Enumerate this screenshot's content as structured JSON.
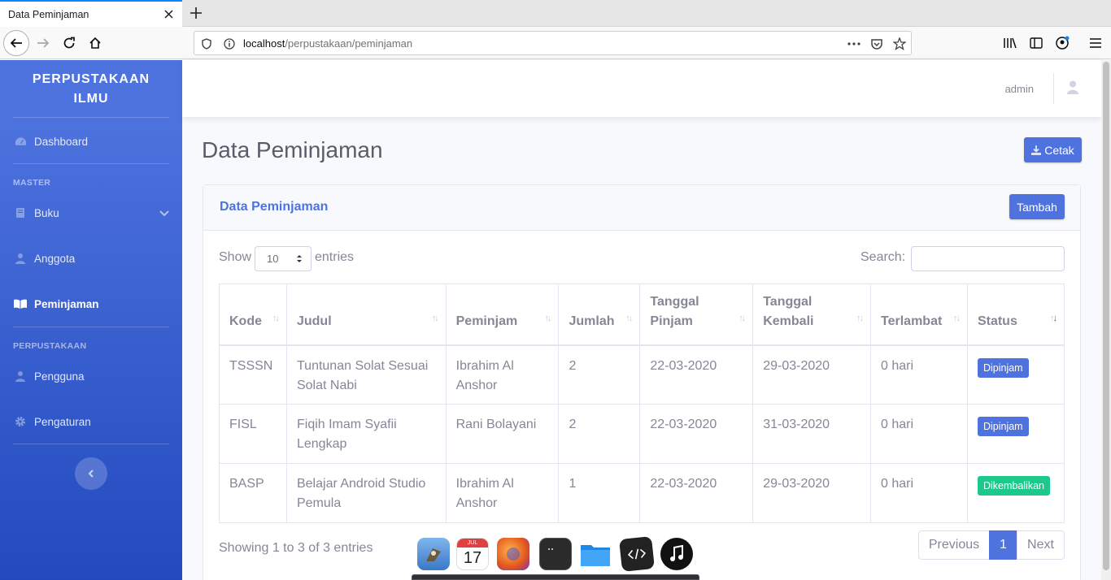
{
  "browser": {
    "tab_title": "Data Peminjaman",
    "url_host": "localhost",
    "url_path": "/perpustakaan/peminjaman"
  },
  "sidebar": {
    "brand_line1": "PERPUSTAKAAN",
    "brand_line2": "ILMU",
    "items": [
      {
        "label": "Dashboard",
        "icon": "dashboard-icon"
      },
      {
        "label": "Buku",
        "icon": "book-icon"
      },
      {
        "label": "Anggota",
        "icon": "user-icon"
      },
      {
        "label": "Peminjaman",
        "icon": "book-open-icon"
      },
      {
        "label": "Pengguna",
        "icon": "user-icon"
      },
      {
        "label": "Pengaturan",
        "icon": "cog-icon"
      }
    ],
    "heading_master": "MASTER",
    "heading_perpustakaan": "PERPUSTAKAAN"
  },
  "topbar": {
    "username": "admin"
  },
  "main": {
    "page_title": "Data Peminjaman",
    "cetak_label": "Cetak",
    "card_title": "Data Peminjaman",
    "tambah_label": "Tambah",
    "show_label": "Show",
    "entries_value": "10",
    "entries_label": "entries",
    "search_label": "Search:",
    "search_value": "",
    "columns": [
      {
        "line1": "Kode",
        "line2": ""
      },
      {
        "line1": "Judul",
        "line2": ""
      },
      {
        "line1": "Peminjam",
        "line2": ""
      },
      {
        "line1": "Jumlah",
        "line2": ""
      },
      {
        "line1": "Tanggal",
        "line2": "Pinjam"
      },
      {
        "line1": "Tanggal",
        "line2": "Kembali"
      },
      {
        "line1": "Terlambat",
        "line2": ""
      },
      {
        "line1": "Status",
        "line2": ""
      }
    ],
    "rows": [
      {
        "kode": "TSSSN",
        "judul": "Tuntunan Solat Sesuai Solat Nabi",
        "peminjam": "Ibrahim Al Anshor",
        "jumlah": "2",
        "tgl_pinjam": "22-03-2020",
        "tgl_kembali": "29-03-2020",
        "terlambat": "0 hari",
        "status": "Dipinjam"
      },
      {
        "kode": "FISL",
        "judul": "Fiqih Imam Syafii Lengkap",
        "peminjam": "Rani Bolayani",
        "jumlah": "2",
        "tgl_pinjam": "22-03-2020",
        "tgl_kembali": "31-03-2020",
        "terlambat": "0 hari",
        "status": "Dipinjam"
      },
      {
        "kode": "BASP",
        "judul": "Belajar Android Studio Pemula",
        "peminjam": "Ibrahim Al Anshor",
        "jumlah": "1",
        "tgl_pinjam": "22-03-2020",
        "tgl_kembali": "29-03-2020",
        "terlambat": "0 hari",
        "status": "Dikembalikan"
      }
    ],
    "info_text": "Showing 1 to 3 of 3 entries",
    "pagination": {
      "previous": "Previous",
      "current": "1",
      "next": "Next"
    }
  },
  "colors": {
    "primary": "#4e73df",
    "success": "#1cc88a",
    "text": "#858796"
  },
  "dock": {
    "calendar_month": "JUL",
    "calendar_day": "17"
  }
}
